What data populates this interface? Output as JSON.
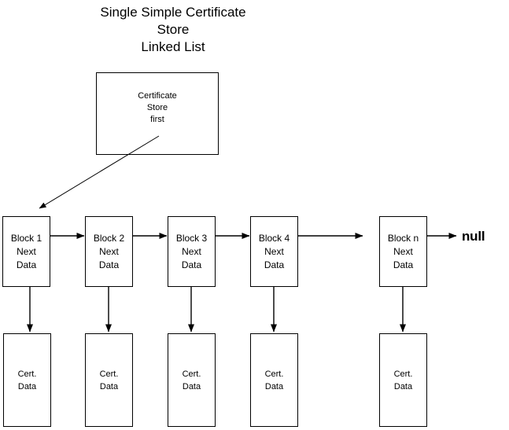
{
  "diagram": {
    "title": "Single Simple Certificate\nStore\nLinked List",
    "store_node": {
      "label": "Certificate\nStore\nfirst"
    },
    "blocks": [
      {
        "label": "Block 1\nNext\nData"
      },
      {
        "label": "Block 2\nNext\nData"
      },
      {
        "label": "Block 3\nNext\nData"
      },
      {
        "label": "Block 4\nNext\nData"
      },
      {
        "label": "Block n\nNext\nData"
      }
    ],
    "cert_nodes": [
      {
        "label": "Cert.\nData"
      },
      {
        "label": "Cert.\nData"
      },
      {
        "label": "Cert.\nData"
      },
      {
        "label": "Cert.\nData"
      },
      {
        "label": "Cert.\nData"
      }
    ],
    "terminator": {
      "label": "null"
    },
    "colors": {
      "background": "#ffffff",
      "stroke": "#000000",
      "text": "#000000"
    }
  }
}
